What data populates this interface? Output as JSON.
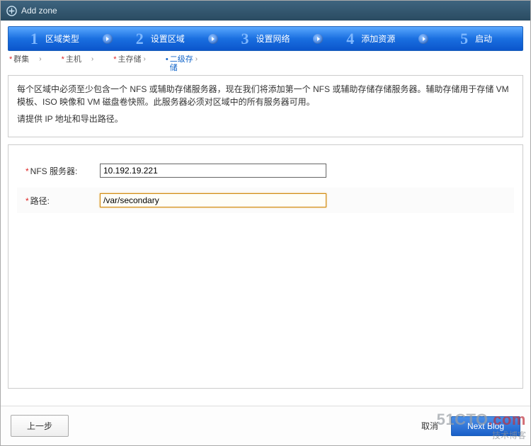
{
  "dialog": {
    "title": "Add zone"
  },
  "steps": [
    {
      "num": "1",
      "label": "区域类型"
    },
    {
      "num": "2",
      "label": "设置区域"
    },
    {
      "num": "3",
      "label": "设置网络"
    },
    {
      "num": "4",
      "label": "添加资源"
    },
    {
      "num": "5",
      "label": "启动"
    }
  ],
  "sub_steps": {
    "items": [
      {
        "label": "群集",
        "marker": "*"
      },
      {
        "label": "主机",
        "marker": "*"
      },
      {
        "label": "主存储",
        "marker": "*"
      },
      {
        "label": "二级存储",
        "marker": "•",
        "active": true
      }
    ]
  },
  "info": {
    "p1": "每个区域中必须至少包含一个 NFS 或辅助存储服务器，现在我们将添加第一个 NFS 或辅助存储存储服务器。辅助存储用于存储 VM 模板、ISO 映像和 VM 磁盘卷快照。此服务器必须对区域中的所有服务器可用。",
    "p2": "请提供 IP 地址和导出路径。"
  },
  "form": {
    "nfs_label": "NFS 服务器:",
    "nfs_value": "10.192.19.221",
    "path_label": "路径:",
    "path_value": "/var/secondary"
  },
  "footer": {
    "prev": "上一步",
    "cancel": "取消",
    "next": "Next Blog"
  },
  "watermark": {
    "brand": "51CTO",
    "suffix": ".com",
    "sub": "技术博客"
  }
}
